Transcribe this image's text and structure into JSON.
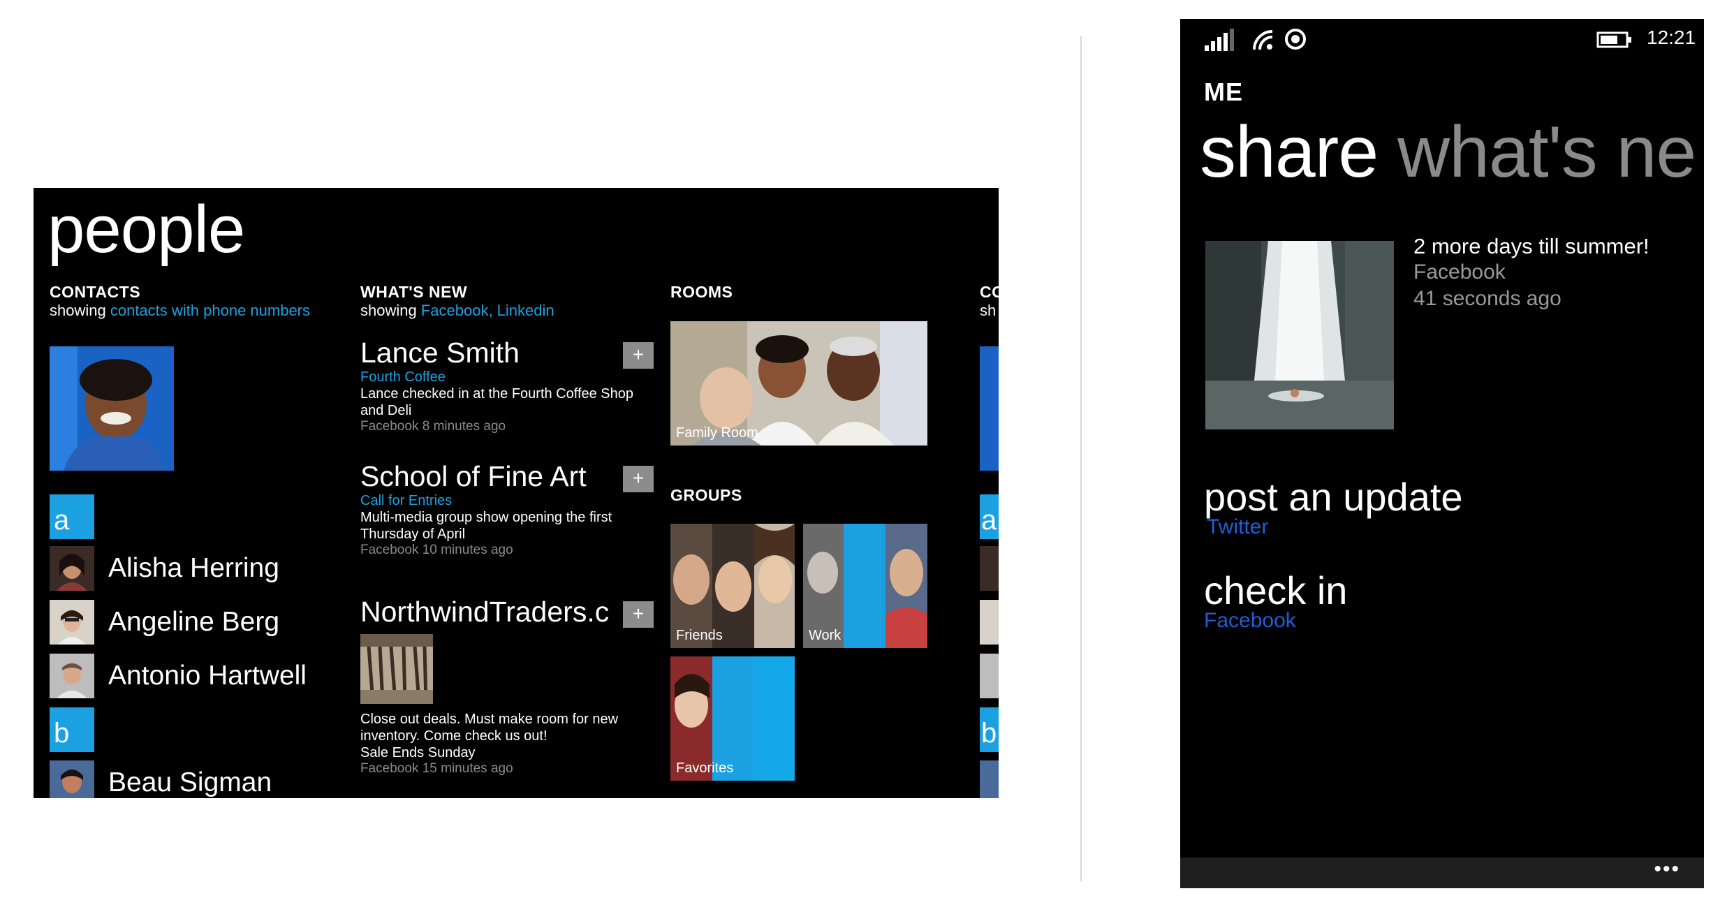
{
  "people_hub": {
    "title": "people",
    "contacts": {
      "heading": "CONTACTS",
      "showing_prefix": "showing",
      "showing_link": "contacts with phone numbers",
      "groups": [
        {
          "letter": "a",
          "people": [
            "Alisha Herring",
            "Angeline Berg",
            "Antonio Hartwell"
          ]
        },
        {
          "letter": "b",
          "people": [
            "Beau Sigman"
          ]
        }
      ]
    },
    "whats_new": {
      "heading": "WHAT'S NEW",
      "showing_prefix": "showing",
      "showing_link": "Facebook, Linkedin",
      "items": [
        {
          "name": "Lance Smith",
          "sub": "Fourth Coffee",
          "text1": "Lance checked in at the Fourth Coffee Shop",
          "text2": "and Deli",
          "meta": "Facebook 8 minutes ago"
        },
        {
          "name": "School of Fine Art",
          "sub": "Call for Entries",
          "text1": "Multi-media group show opening the first",
          "text2": "Thursday of April",
          "meta": "Facebook 10 minutes ago"
        },
        {
          "name": "NorthwindTraders.c",
          "text1": "Close out deals. Must make room for new",
          "text2": "inventory. Come check us out!",
          "text3": "Sale Ends Sunday",
          "meta": "Facebook 15 minutes ago"
        }
      ]
    },
    "rooms": {
      "heading": "ROOMS",
      "tiles": [
        "Family Room"
      ]
    },
    "groups": {
      "heading": "GROUPS",
      "tiles": [
        "Friends",
        "Work",
        "Favorites"
      ]
    },
    "peek": {
      "heading": "CO",
      "sub": "sh",
      "letters": [
        "a",
        "b"
      ]
    }
  },
  "phone": {
    "status": {
      "time": "12:21"
    },
    "header": "ME",
    "pivot": {
      "active": "share",
      "next": "what's ne"
    },
    "latest": {
      "text": "2 more days till summer!",
      "source": "Facebook",
      "time": "41 seconds ago"
    },
    "actions": [
      {
        "title": "post an update",
        "sub": "Twitter"
      },
      {
        "title": "check in",
        "sub": "Facebook"
      }
    ],
    "appbar": {
      "more": "•••"
    }
  },
  "colors": {
    "accent": "#1ba1e2",
    "link_blue": "#1f5fd6",
    "background": "#000000"
  }
}
